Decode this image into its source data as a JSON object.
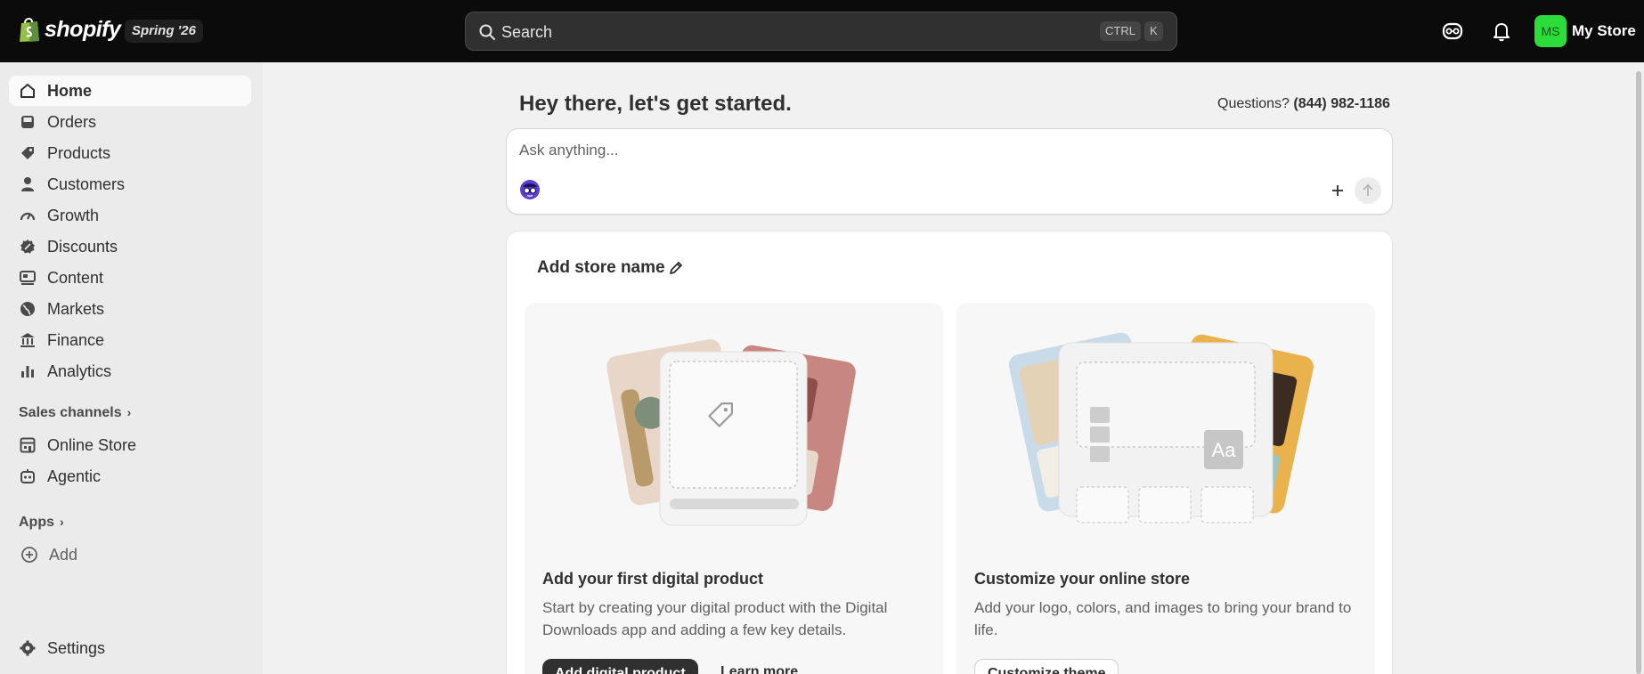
{
  "topbar": {
    "brand": "shopify",
    "edition": "Spring '26",
    "search": {
      "placeholder": "Search",
      "shortcut_mod": "CTRL",
      "shortcut_key": "K"
    },
    "avatar_initials": "MS",
    "store_name": "My Store",
    "avatar_color": "#2cdc3a"
  },
  "sidebar": {
    "items": [
      {
        "label": "Home",
        "icon": "home-icon",
        "active": true
      },
      {
        "label": "Orders",
        "icon": "inbox-icon"
      },
      {
        "label": "Products",
        "icon": "tag-icon"
      },
      {
        "label": "Customers",
        "icon": "person-icon"
      },
      {
        "label": "Growth",
        "icon": "gauge-icon"
      },
      {
        "label": "Discounts",
        "icon": "discount-icon"
      },
      {
        "label": "Content",
        "icon": "content-icon"
      },
      {
        "label": "Markets",
        "icon": "globe-icon"
      },
      {
        "label": "Finance",
        "icon": "bank-icon"
      },
      {
        "label": "Analytics",
        "icon": "bar-chart-icon"
      }
    ],
    "sales_channels_label": "Sales channels",
    "channels": [
      {
        "label": "Online Store",
        "icon": "store-icon"
      },
      {
        "label": "Agentic",
        "icon": "agent-icon"
      }
    ],
    "apps_label": "Apps",
    "add_label": "Add",
    "settings_label": "Settings"
  },
  "main": {
    "greeting": "Hey there, let's get started.",
    "questions_label": "Questions?",
    "questions_phone": "(844) 982-1186",
    "ask_placeholder": "Ask anything...",
    "store_card": {
      "title": "Add store name",
      "tasks": [
        {
          "title": "Add your first digital product",
          "description": "Start by creating your digital product with the Digital Downloads app and adding a few key details.",
          "primary_button": "Add digital product",
          "secondary_button": "Learn more"
        },
        {
          "title": "Customize your online store",
          "description": "Add your logo, colors, and images to bring your brand to life.",
          "primary_button": "Customize theme",
          "tile_label": "Aa"
        }
      ]
    }
  }
}
